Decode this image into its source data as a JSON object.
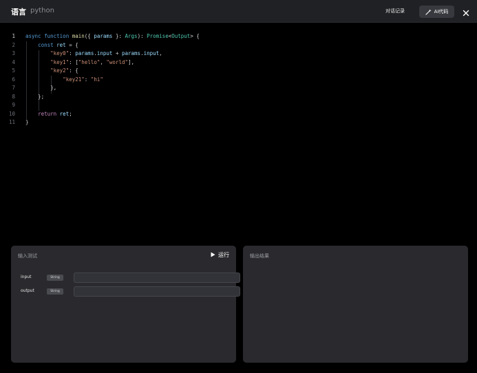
{
  "header": {
    "title": "语言",
    "language": "python",
    "history_label": "对话记录",
    "ai_label": "AI代码"
  },
  "editor": {
    "lines": [
      {
        "num": "1",
        "tokens": [
          {
            "t": "async function ",
            "c": "kw"
          },
          {
            "t": "main",
            "c": "fn"
          },
          {
            "t": "({ ",
            "c": "pl"
          },
          {
            "t": "params",
            "c": "var"
          },
          {
            "t": " }: ",
            "c": "pl"
          },
          {
            "t": "Args",
            "c": "ty"
          },
          {
            "t": "): ",
            "c": "pl"
          },
          {
            "t": "Promise",
            "c": "ty"
          },
          {
            "t": "<",
            "c": "pl"
          },
          {
            "t": "Output",
            "c": "ty"
          },
          {
            "t": "> {",
            "c": "pl"
          }
        ]
      },
      {
        "num": "2",
        "tokens": [
          {
            "t": "    ",
            "c": "pl"
          },
          {
            "t": "const ",
            "c": "kw"
          },
          {
            "t": "ret",
            "c": "var"
          },
          {
            "t": " = {",
            "c": "pl"
          }
        ]
      },
      {
        "num": "3",
        "tokens": [
          {
            "t": "        ",
            "c": "pl"
          },
          {
            "t": "\"key0\"",
            "c": "str"
          },
          {
            "t": ": ",
            "c": "pl"
          },
          {
            "t": "params",
            "c": "var"
          },
          {
            "t": ".",
            "c": "pl"
          },
          {
            "t": "input",
            "c": "var"
          },
          {
            "t": " + ",
            "c": "pl"
          },
          {
            "t": "params",
            "c": "var"
          },
          {
            "t": ".",
            "c": "pl"
          },
          {
            "t": "input",
            "c": "var"
          },
          {
            "t": ",",
            "c": "pl"
          }
        ]
      },
      {
        "num": "4",
        "tokens": [
          {
            "t": "        ",
            "c": "pl"
          },
          {
            "t": "\"key1\"",
            "c": "str"
          },
          {
            "t": ": [",
            "c": "pl"
          },
          {
            "t": "\"hello\"",
            "c": "str"
          },
          {
            "t": ", ",
            "c": "pl"
          },
          {
            "t": "\"world\"",
            "c": "str"
          },
          {
            "t": "],",
            "c": "pl"
          }
        ]
      },
      {
        "num": "5",
        "tokens": [
          {
            "t": "        ",
            "c": "pl"
          },
          {
            "t": "\"key2\"",
            "c": "str"
          },
          {
            "t": ": {",
            "c": "pl"
          }
        ]
      },
      {
        "num": "6",
        "tokens": [
          {
            "t": "            ",
            "c": "pl"
          },
          {
            "t": "\"key21\"",
            "c": "str"
          },
          {
            "t": ": ",
            "c": "pl"
          },
          {
            "t": "\"hi\"",
            "c": "str"
          }
        ]
      },
      {
        "num": "7",
        "tokens": [
          {
            "t": "        },",
            "c": "pl"
          }
        ]
      },
      {
        "num": "8",
        "tokens": [
          {
            "t": "    };",
            "c": "pl"
          }
        ]
      },
      {
        "num": "9",
        "tokens": []
      },
      {
        "num": "10",
        "tokens": [
          {
            "t": "    ",
            "c": "pl"
          },
          {
            "t": "return ",
            "c": "kw2"
          },
          {
            "t": "ret",
            "c": "var"
          },
          {
            "t": ";",
            "c": "pl"
          }
        ]
      },
      {
        "num": "11",
        "tokens": [
          {
            "t": "}",
            "c": "pl"
          }
        ]
      }
    ]
  },
  "input_panel": {
    "title": "输入测试",
    "run_label": "运行",
    "fields": [
      {
        "name": "input",
        "type": "String",
        "value": ""
      },
      {
        "name": "output",
        "type": "String",
        "value": ""
      }
    ]
  },
  "output_panel": {
    "title": "输出结果"
  },
  "colors": {
    "background": "#000000",
    "header_bg": "#202124",
    "panel_bg": "#2a2a2e",
    "keyword": "#569cd6",
    "string": "#ce9178",
    "function": "#dcdcaa"
  },
  "icons": {
    "ai": "magic-wand-icon",
    "close": "close-icon",
    "run": "play-icon"
  }
}
